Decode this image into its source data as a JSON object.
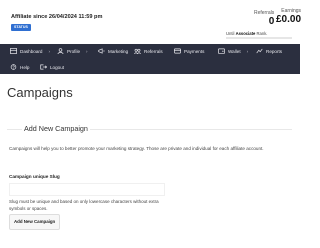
{
  "header": {
    "affiliate_since": "Affiliate since 26/04/2024 11:59 pm",
    "status_badge": "STATUS",
    "referrals": {
      "label": "Referrals",
      "value": "0"
    },
    "earnings": {
      "label": "Earnings",
      "value": "£0.00"
    },
    "rank": {
      "prefix": "Until",
      "name": "Associate",
      "suffix": "Rank.",
      "progress_fraction": 0.0
    }
  },
  "nav": {
    "items": [
      {
        "label": "Dashboard",
        "icon": "dashboard-icon",
        "has_caret": true
      },
      {
        "label": "Profile",
        "icon": "profile-icon",
        "has_caret": true
      },
      {
        "label": "Marketing",
        "icon": "marketing-icon",
        "has_caret": false
      },
      {
        "label": "Referrals",
        "icon": "referrals-icon",
        "has_caret": false
      },
      {
        "label": "Payments",
        "icon": "payments-icon",
        "has_caret": false
      },
      {
        "label": "Wallet",
        "icon": "wallet-icon",
        "has_caret": true
      },
      {
        "label": "Reports",
        "icon": "reports-icon",
        "has_caret": false
      },
      {
        "label": "Help",
        "icon": "help-icon",
        "has_caret": false
      },
      {
        "label": "Logout",
        "icon": "logout-icon",
        "has_caret": false
      }
    ],
    "background_color": "#2b2f3f"
  },
  "main": {
    "title": "Campaigns",
    "section_title": "Add New Campaign",
    "description": "Campaigns will help you to better promote your marketing strategy. Those are private and individual for each affiliate account.",
    "field": {
      "label": "Campaign unique Slug",
      "value": "",
      "placeholder": ""
    },
    "hint": "Slug must be unique and based on only lowercase characters without extra symbols or spaces.",
    "submit_label": "Add New Campaign"
  },
  "colors": {
    "accent": "#2f6fd1",
    "progress": "#23b7a8"
  }
}
